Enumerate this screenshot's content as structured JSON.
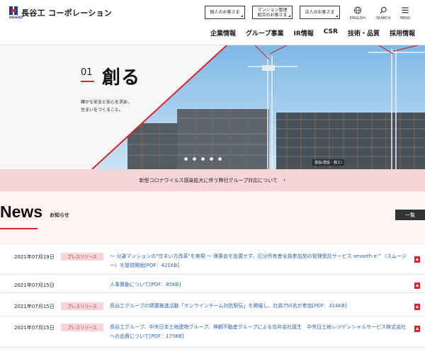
{
  "header": {
    "logo_text": "長谷工 コーポレーション",
    "logo_small": "HASEKO",
    "buttons": [
      {
        "label": "個人のお客さま"
      },
      {
        "label_line1": "マンション管理",
        "label_line2": "組合のお客さま"
      },
      {
        "label": "法人のお客さま"
      }
    ],
    "utilities": [
      {
        "label": "ENGLISH",
        "icon": "globe-icon"
      },
      {
        "label": "SEARCH",
        "icon": "search-icon"
      },
      {
        "label": "MENU",
        "icon": "menu-icon"
      }
    ],
    "nav": [
      "企業情報",
      "グループ事業",
      "IR情報",
      "CSR",
      "技術・品質",
      "採用情報"
    ]
  },
  "hero": {
    "number": "01",
    "title": "創る",
    "subtitle_line1": "確かな安全と安心を求め、",
    "subtitle_line2": "住まいをつくること。",
    "caption": "建設(建設・施工)",
    "slides": 5
  },
  "notice": {
    "text": "新型コロナウイルス感染拡大に伴う弊社グループ対応について"
  },
  "news": {
    "title": "News",
    "subtitle": "お知らせ",
    "list_button": "一覧",
    "items": [
      {
        "date": "2021年07月19日",
        "tag": "プレスリリース",
        "text": "〜 分譲マンションの\"住まい方改革\"を実現 〜 理事会を設置せず、区分所有者全員参加型の管理受託サービス smooth-e™（スムージー）を提供開始[PDF：421KB]"
      },
      {
        "date": "2021年07月15日",
        "tag": "",
        "text": "人事異動について[PDF：85KB]"
      },
      {
        "date": "2021年07月15日",
        "tag": "プレスリリース",
        "text": "長谷工グループの健康推進活動「オンラインチーム対抗駅伝」を開催し、社員750名が参加[PDF：314KB]"
      },
      {
        "date": "2021年07月15日",
        "tag": "プレスリリース",
        "text": "長谷工グループ、中央日本土地建物グループ、神鋼不動産グループによる合弁会社誕生　中央日土地レジデンシャルサービス株式会社への出資について[PDF：175KB]"
      }
    ]
  },
  "colors": {
    "accent_red": "#d6262e",
    "notice_pink": "#f7d4d8",
    "link_blue": "#2a62b5",
    "sky": "#8fc4ea"
  }
}
